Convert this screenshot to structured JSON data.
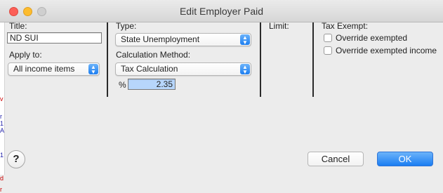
{
  "window": {
    "title": "Edit Employer Paid"
  },
  "title_field": {
    "label": "Title:",
    "value": "ND SUI"
  },
  "apply_to": {
    "label": "Apply to:",
    "selected": "All income items"
  },
  "type": {
    "label": "Type:",
    "selected": "State Unemployment"
  },
  "calc_method": {
    "label": "Calculation Method:",
    "selected": "Tax Calculation"
  },
  "percent": {
    "label": "%",
    "value": "2.35"
  },
  "limit": {
    "label": "Limit:"
  },
  "tax_exempt": {
    "label": "Tax Exempt:",
    "options": [
      {
        "label": "Override exempted",
        "checked": false
      },
      {
        "label": "Override exempted income",
        "checked": false
      }
    ]
  },
  "buttons": {
    "help": "?",
    "cancel": "Cancel",
    "ok": "OK"
  },
  "colors": {
    "accent": "#1d7ef0",
    "close": "#fc5f57",
    "minimize": "#fdbc2e"
  }
}
